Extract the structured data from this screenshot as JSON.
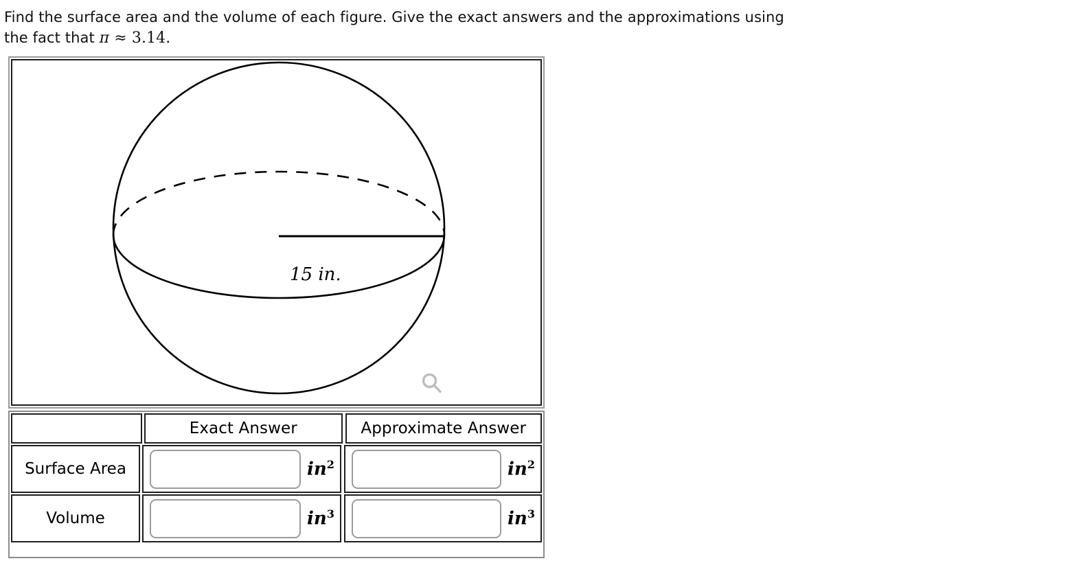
{
  "prompt": {
    "line1_a": "Find the surface area and the volume of each figure. Give the exact answers and the approximations using",
    "line2_a": "the fact that ",
    "pi_symbol": "π",
    "approx_symbol": "≈",
    "pi_value": "3.14."
  },
  "figure": {
    "shape": "sphere",
    "radius_label": "15 in.",
    "zoom_icon_name": "magnifier-icon"
  },
  "table": {
    "headers": {
      "corner": "",
      "exact": "Exact Answer",
      "approximate": "Approximate Answer"
    },
    "rows": [
      {
        "label": "Surface Area",
        "exact_value": "",
        "exact_unit_base": "in",
        "exact_unit_exp": "2",
        "approx_value": "",
        "approx_unit_base": "in",
        "approx_unit_exp": "2"
      },
      {
        "label": "Volume",
        "exact_value": "",
        "exact_unit_base": "in",
        "exact_unit_exp": "3",
        "approx_value": "",
        "approx_unit_base": "in",
        "approx_unit_exp": "3"
      }
    ]
  },
  "colors": {
    "panel_outer_border": "#9a9a9a",
    "panel_inner_border": "#1c1c1c",
    "cell_border": "#1e1e1e",
    "input_border": "#9b9b9b",
    "stroke": "#000000",
    "zoom_icon": "#bdbdbd"
  }
}
